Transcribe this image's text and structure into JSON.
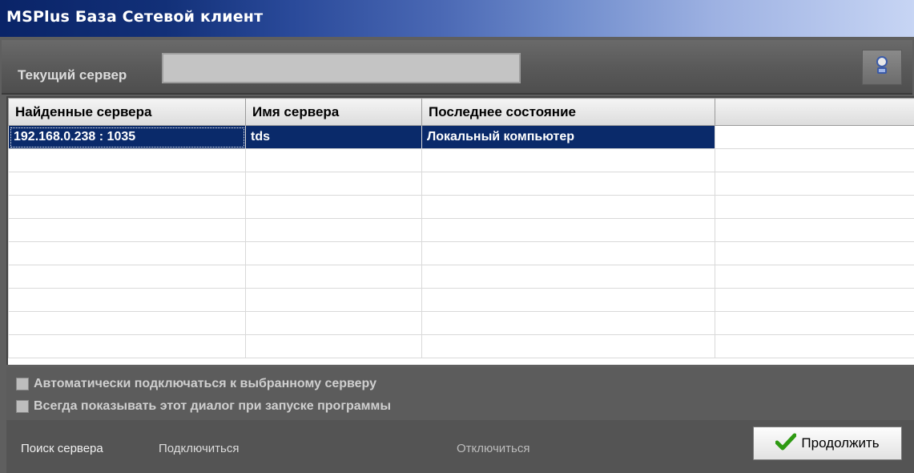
{
  "window": {
    "title": "MSPlus База Сетевой клиент"
  },
  "server": {
    "label": "Текущий сервер",
    "value": ""
  },
  "table": {
    "columns": [
      "Найденные сервера",
      "Имя сервера",
      "Последнее состояние",
      ""
    ],
    "rows": [
      [
        "192.168.0.238 : 1035",
        "tds",
        "Локальный компьютер",
        ""
      ]
    ]
  },
  "options": {
    "auto_connect": "Автоматически подключаться к выбранному серверу",
    "always_show": "Всегда показывать этот диалог при запуске программы"
  },
  "actions": {
    "search": "Поиск сервера",
    "connect": "Подключиться",
    "disconnect": "Отключиться",
    "continue": "Продолжить"
  },
  "colors": {
    "selection": "#0a2a6a",
    "panel": "#5c5c5c",
    "accent_check": "#2e9a12"
  },
  "icons": {
    "server_button": "server-search-icon",
    "continue": "checkmark-icon"
  }
}
